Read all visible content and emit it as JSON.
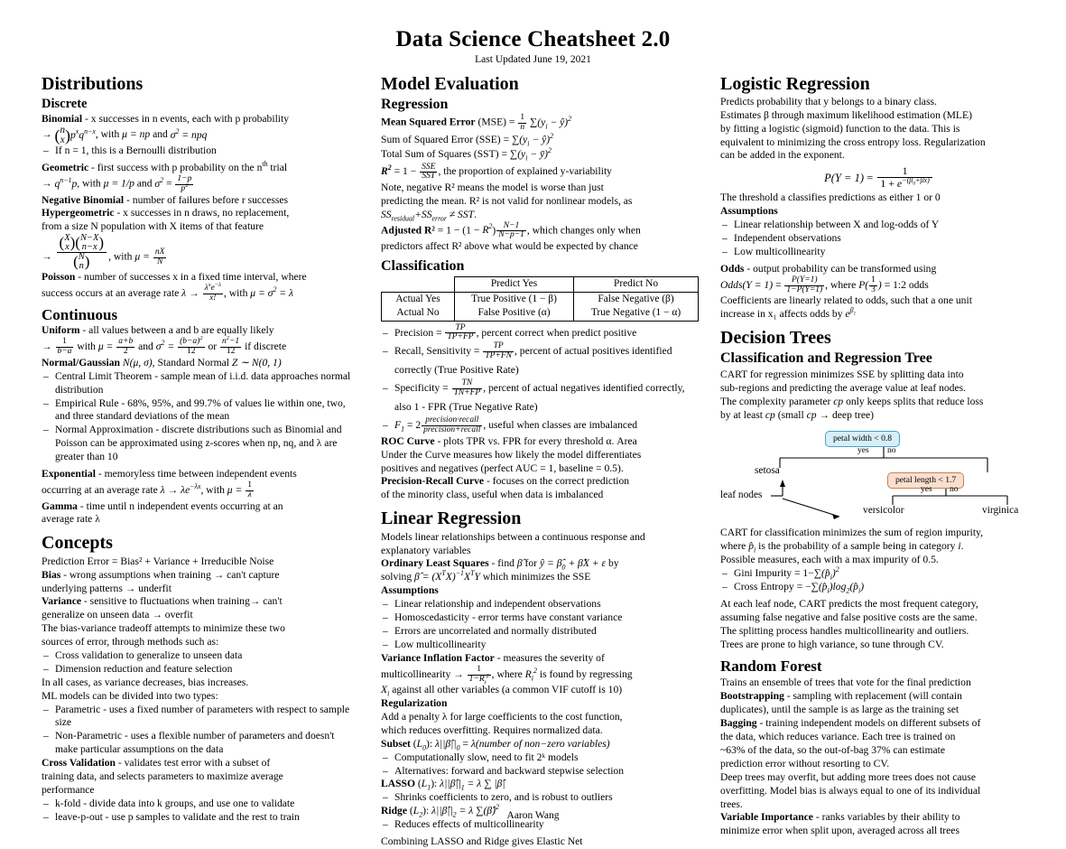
{
  "header": {
    "title": "Data Science Cheatsheet 2.0",
    "subtitle": "Last Updated June 19, 2021"
  },
  "footer": {
    "author": "Aaron Wang"
  },
  "colors": {
    "tree_node_split_fill": "#d6eff8",
    "tree_node_split_border": "#4a9ec4",
    "tree_node_leaf_fill": "#fadfcf",
    "tree_node_leaf_border": "#c97f4e"
  },
  "columns": {
    "left": {
      "sections": {
        "distributions": {
          "title": "Distributions",
          "discrete": {
            "title": "Discrete",
            "binomial_label": "Binomial",
            "binomial_text": "- x successes in n events, each with p probability",
            "binomial_formula_lead": ", with",
            "binomial_bullet": "If n = 1, this is a Bernoulli distribution",
            "geometric_label": "Geometric",
            "geometric_text": "- first success with p probability on the n",
            "geometric_text_end": " trial",
            "negbinom_label": "Negative Binomial",
            "negbinom_text": "- number of failures before r successes",
            "hypergeom_label": "Hypergeometric",
            "hypergeom_text": "- x successes in n draws, no replacement,",
            "hypergeom_text2": "from a size N population with X items of that feature",
            "poisson_label": "Poisson",
            "poisson_text": "- number of successes x in a fixed time interval, where",
            "poisson_text2": "success occurs at an average rate"
          },
          "continuous": {
            "title": "Continuous",
            "uniform_label": "Uniform",
            "uniform_text": "- all values between a and b are equally likely",
            "uniform_discrete_tail": "if discrete",
            "normal_label": "Normal/Gaussian",
            "bullets": [
              "Central Limit Theorem - sample mean of i.i.d. data approaches normal distribution",
              "Empirical Rule - 68%, 95%, and 99.7% of values lie within one, two, and three standard deviations of the mean",
              "Normal Approximation - discrete distributions such as Binomial and Poisson can be approximated using z-scores when np, nq, and λ are greater than 10"
            ],
            "exponential_label": "Exponential",
            "exponential_text": "- memoryless time between independent events",
            "exponential_text2": "occurring at an average rate",
            "gamma_label": "Gamma",
            "gamma_text": "- time until n independent events occurring at an",
            "gamma_text2": "average rate λ"
          }
        },
        "concepts": {
          "title": "Concepts",
          "prediction_error": "Prediction Error = Bias² + Variance + Irreducible Noise",
          "bias_label": "Bias",
          "bias_text": "- wrong assumptions when training → can't capture",
          "bias_text2": "underlying patterns → underfit",
          "variance_label": "Variance",
          "variance_text": "- sensitive to fluctuations when training→ can't",
          "variance_text2": "generalize on unseen data → overfit",
          "tradeoff_text": "The bias-variance tradeoff attempts to minimize these two",
          "tradeoff_text2": "sources of error, through methods such as:",
          "tradeoff_bullets": [
            "Cross validation to generalize to unseen data",
            "Dimension reduction and feature selection"
          ],
          "variance_decreases": "In all cases, as variance decreases, bias increases.",
          "ml_types_lead": "ML models can be divided into two types:",
          "ml_types_bullets": [
            "Parametric - uses a fixed number of parameters with respect to sample size",
            "Non-Parametric - uses a flexible number of parameters and doesn't make particular assumptions on the data"
          ],
          "cv_label": "Cross Validation",
          "cv_text": "- validates test error with a subset of",
          "cv_text2": "training data, and selects parameters to maximize average",
          "cv_text3": "performance",
          "cv_bullets": [
            "k-fold - divide data into k groups, and use one to validate",
            "leave-p-out - use p samples to validate and the rest to train"
          ]
        }
      }
    },
    "middle": {
      "sections": {
        "model_evaluation": {
          "title": "Model Evaluation",
          "regression": {
            "title": "Regression",
            "mse_label": "Mean Squared Error",
            "mse_rest": "(MSE) =",
            "sse_label": "Sum of Squared Error (SSE) =",
            "sst_label": "Total Sum of Squares (SST) =",
            "r2_text": ", the proportion of explained y-variability",
            "r2_note1": "Note, negative R² means the model is worse than just",
            "r2_note2": "predicting the mean. R² is not valid for nonlinear models, as",
            "adjusted_label": "Adjusted R²",
            "adjusted_tail": ", which changes only when",
            "adjusted_tail2": "predictors affect R² above what would be expected by chance"
          },
          "classification": {
            "title": "Classification",
            "table": {
              "col_headers": [
                "",
                "Predict Yes",
                "Predict No"
              ],
              "rows": [
                {
                  "header": "Actual Yes",
                  "cells": [
                    "True Positive (1 − β)",
                    "False Negative (β)"
                  ]
                },
                {
                  "header": "Actual No",
                  "cells": [
                    "False Positive (α)",
                    "True Negative (1 − α)"
                  ]
                }
              ]
            },
            "bullets": [
              "Precision, percent correct when predict positive",
              "Recall, Sensitivity, percent of actual positives identified correctly (True Positive Rate)",
              "Specificity, percent of actual negatives identified correctly, also 1 - FPR (True Negative Rate)",
              "F1, useful when classes are imbalanced"
            ],
            "roc_label": "ROC Curve",
            "roc_text": "- plots TPR vs. FPR for every threshold α. Area",
            "roc_text2": "Under the Curve measures how likely the model differentiates",
            "roc_text3": "positives and negatives (perfect AUC = 1, baseline = 0.5).",
            "pr_label": "Precision-Recall Curve",
            "pr_text": "- focuses on the correct prediction",
            "pr_text2": "of the minority class, useful when data is imbalanced"
          }
        },
        "linear_regression": {
          "title": "Linear Regression",
          "intro1": "Models linear relationships between a continuous response and",
          "intro2": "explanatory variables",
          "ols_label": "Ordinary Least Squares",
          "ols_tail": "by",
          "ols_tail2": "which minimizes the SSE",
          "assumptions_title": "Assumptions",
          "assumptions": [
            "Linear relationship and independent observations",
            "Homoscedasticity - error terms have constant variance",
            "Errors are uncorrelated and normally distributed",
            "Low multicollinearity"
          ],
          "vif_label": "Variance Inflation Factor",
          "vif_text": "- measures the severity of",
          "vif_text2": "multicollinearity →",
          "vif_text3": "is found by regressing",
          "vif_text4": "against all other variables (a common VIF cutoff is 10)",
          "regularization_title": "Regularization",
          "reg_text1": "Add a penalty λ for large coefficients to the cost function,",
          "reg_text2": "which reduces overfitting. Requires normalized data.",
          "subset_label": "Subset",
          "subset_rhs": "λ(number of non−zero variables)",
          "subset_bullets": [
            "Computationally slow, need to fit 2ᵏ models",
            "Alternatives: forward and backward stepwise selection"
          ],
          "lasso_label": "LASSO",
          "lasso_bullets": [
            "Shrinks coefficients to zero, and is robust to outliers"
          ],
          "ridge_label": "Ridge",
          "ridge_bullets": [
            "Reduces effects of multicollinearity"
          ],
          "elastic_net": "Combining LASSO and Ridge gives Elastic Net"
        }
      }
    },
    "right": {
      "sections": {
        "logistic_regression": {
          "title": "Logistic Regression",
          "intro": [
            "Predicts probability that y belongs to a binary class.",
            "Estimates β through maximum likelihood estimation (MLE)",
            "by fitting a logistic (sigmoid) function to the data. This is",
            "equivalent to minimizing the cross entropy loss. Regularization",
            "can be added in the exponent."
          ],
          "threshold_text": "The threshold a classifies predictions as either 1 or 0",
          "assumptions_title": "Assumptions",
          "assumptions": [
            "Linear relationship between X and log-odds of Y",
            "Independent observations",
            "Low multicollinearity"
          ],
          "odds_label": "Odds",
          "odds_text": "- output probability can be transformed using",
          "odds_tail": "= 1:2 odds",
          "coef_text1": "Coefficients are linearly related to odds, such that a one unit",
          "coef_text2": "increase in x₁ affects odds by"
        },
        "decision_trees": {
          "title": "Decision Trees",
          "cart": {
            "title": "Classification and Regression Tree",
            "text1": "CART for regression minimizes SSE by splitting data into",
            "text2": "sub-regions and predicting the average value at leaf nodes.",
            "text3": "The complexity parameter cp only keeps splits that reduce loss",
            "text4": "by at least cp (small cp → deep tree)",
            "tree": {
              "root_label": "petal width < 0.8",
              "root_yes": "yes",
              "root_no": "no",
              "leaf_left": "setosa",
              "second_label": "petal length < 1.7",
              "second_yes": "yes",
              "second_no": "no",
              "leaf_mid": "versicolor",
              "leaf_right": "virginica",
              "annotation": "leaf nodes"
            },
            "text5": "CART for classification minimizes the sum of region impurity,",
            "text6": "where p̂ᵢ is the probability of a sample being in category i.",
            "text7": "Possible measures, each with a max impurity of 0.5.",
            "measures": [
              "Gini Impurity",
              "Cross Entropy"
            ],
            "text8": "At each leaf node, CART predicts the most frequent category,",
            "text9": "assuming false negative and false positive costs are the same.",
            "text10": "The splitting process handles multicollinearity and outliers.",
            "text11": "Trees are prone to high variance, so tune through CV."
          }
        },
        "random_forest": {
          "title": "Random Forest",
          "intro": "Trains an ensemble of trees that vote for the final prediction",
          "bootstrap_label": "Bootstrapping",
          "bootstrap_text": "- sampling with replacement (will contain",
          "bootstrap_text2": "duplicates), until the sample is as large as the training set",
          "bagging_label": "Bagging",
          "bagging_text": "- training independent models on different subsets of",
          "bagging_text2": "the data, which reduces variance. Each tree is trained on",
          "bagging_text3": "~63% of the data, so the out-of-bag 37% can estimate",
          "bagging_text4": "prediction error without resorting to CV.",
          "deep_text1": "Deep trees may overfit, but adding more trees does not cause",
          "deep_text2": "overfitting. Model bias is always equal to one of its individual",
          "deep_text3": "trees.",
          "vi_label": "Variable Importance",
          "vi_text": "- ranks variables by their ability to",
          "vi_text2": "minimize error when split upon, averaged across all trees"
        }
      }
    }
  }
}
